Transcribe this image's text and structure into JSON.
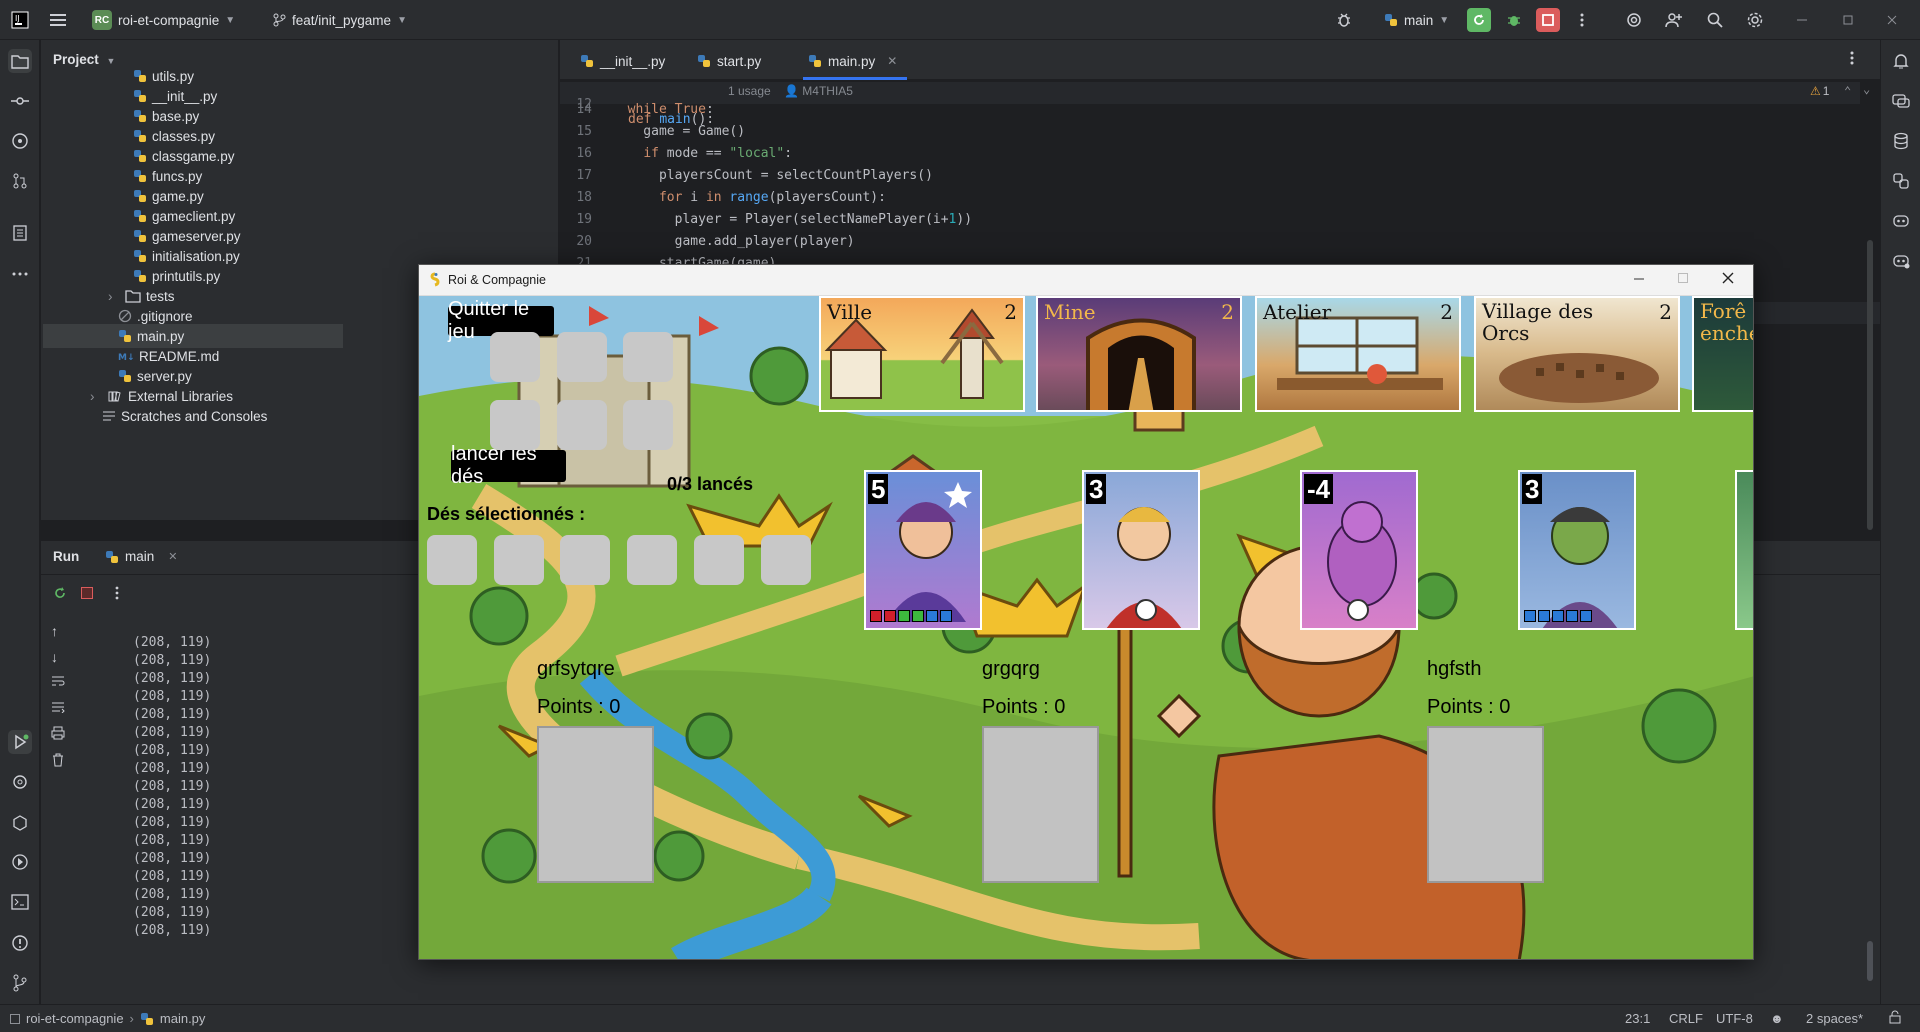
{
  "titlebar": {
    "project_badge": "RC",
    "project_name": "roi-et-compagnie",
    "branch": "feat/init_pygame",
    "run_config": "main"
  },
  "project_panel": {
    "title": "Project",
    "items": [
      {
        "label": "utils.py",
        "type": "py"
      },
      {
        "label": "__init__.py",
        "type": "py"
      },
      {
        "label": "base.py",
        "type": "py"
      },
      {
        "label": "classes.py",
        "type": "py"
      },
      {
        "label": "classgame.py",
        "type": "py"
      },
      {
        "label": "funcs.py",
        "type": "py"
      },
      {
        "label": "game.py",
        "type": "py"
      },
      {
        "label": "gameclient.py",
        "type": "py"
      },
      {
        "label": "gameserver.py",
        "type": "py"
      },
      {
        "label": "initialisation.py",
        "type": "py"
      },
      {
        "label": "printutils.py",
        "type": "py"
      },
      {
        "label": "tests",
        "type": "folder"
      },
      {
        "label": ".gitignore",
        "type": "git"
      },
      {
        "label": "main.py",
        "type": "py"
      },
      {
        "label": "README.md",
        "type": "md"
      },
      {
        "label": "server.py",
        "type": "py"
      },
      {
        "label": "External Libraries",
        "type": "lib"
      },
      {
        "label": "Scratches and Consoles",
        "type": "scratch"
      }
    ]
  },
  "editor": {
    "tabs": [
      {
        "label": "__init__.py"
      },
      {
        "label": "start.py"
      },
      {
        "label": "main.py"
      }
    ],
    "sticky_header": {
      "line": "12",
      "code": "def main():",
      "usages": "1 usage",
      "author": "M4THIA5"
    },
    "warning_count": "1",
    "lines": [
      {
        "n": "14",
        "code": "  while True:"
      },
      {
        "n": "15",
        "code": "    game = Game()"
      },
      {
        "n": "16",
        "code": "    if mode == \"local\":"
      },
      {
        "n": "17",
        "code": "      playersCount = selectCountPlayers()"
      },
      {
        "n": "18",
        "code": "      for i in range(playersCount):"
      },
      {
        "n": "19",
        "code": "        player = Player(selectNamePlayer(i+1))"
      },
      {
        "n": "20",
        "code": "        game.add_player(player)"
      },
      {
        "n": "21",
        "code": "      startGame(game)"
      }
    ]
  },
  "run_panel": {
    "title": "Run",
    "tab": "main",
    "output_line": "(208, 119)",
    "output_count": 17
  },
  "game_window": {
    "title": "Roi & Compagnie",
    "quit_button": "Quitter le jeu",
    "roll_button": "lancer les dés",
    "rolls_label": "0/3 lancés",
    "selected_dice_label": "Dés sélectionnés :",
    "cities": [
      {
        "name": "Ville",
        "value": "2"
      },
      {
        "name": "Mine",
        "value": "2"
      },
      {
        "name": "Atelier",
        "value": "2"
      },
      {
        "name": "Village des Orcs",
        "value": "2"
      },
      {
        "name": "Forê enche",
        "value": ""
      }
    ],
    "characters": [
      {
        "value": "5"
      },
      {
        "value": "3"
      },
      {
        "value": "-4"
      },
      {
        "value": "3"
      }
    ],
    "players": [
      {
        "name": "grfsytqre",
        "points": "Points : 0"
      },
      {
        "name": "grgqrg",
        "points": "Points : 0"
      },
      {
        "name": "hgfsth",
        "points": "Points : 0"
      }
    ]
  },
  "statusbar": {
    "breadcrumb_project": "roi-et-compagnie",
    "breadcrumb_file": "main.py",
    "position": "23:1",
    "line_ending": "CRLF",
    "encoding": "UTF-8",
    "indent": "2 spaces*"
  },
  "colors": {
    "accent": "#3574f0",
    "run_green": "#5fb865",
    "stop_red": "#db5c5c",
    "python_blue": "#3d7ab8"
  }
}
